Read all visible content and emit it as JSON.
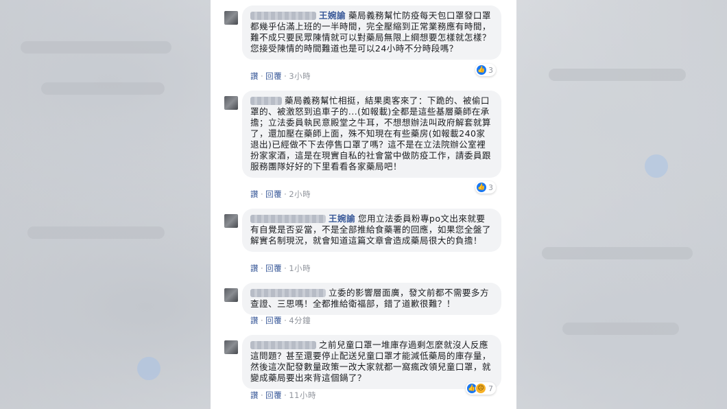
{
  "comments": [
    {
      "author": "王婉諭",
      "text": "藥局義務幫忙防疫每天包口罩發口罩都幾乎佔滿上班的一半時間，完全壓縮到正常業務應有時間，難不成只要民眾陳情就可以對藥局無限上綱想要怎樣就怎樣？您接受陳情的時間難道也是可以24小時不分時段嗎？",
      "reply_label": "讚",
      "reply_action": "回覆",
      "time": "3小時",
      "reaction_count": "3"
    },
    {
      "author": "",
      "text": "藥局義務幫忙相挺，結果奧客來了：下跪的、被偷口罩的、被激怒到追車子的...(如報載)全都是這些基層藥師在承擔；立法委員執民意殿堂之牛耳，不想想辦法叫政府解套就算了，還加壓在藥師上面，殊不知現在有些藥房(如報載240家退出)已經做不下去停售口罩了嗎？這不是在立法院辦公室裡扮家家酒，這是在現實自私的社會當中做防疫工作，請委員跟服務團隊好好的下里看看各家藥局吧！",
      "reply_label": "讚",
      "reply_action": "回覆",
      "time": "2小時",
      "reaction_count": "3"
    },
    {
      "author": "王婉諭",
      "text": "您用立法委員粉專po文出來就要有自覺是否妥當，不是全部推給食藥署的回應，如果您全盤了解實名制現況，就會知道這篇文章會造成藥局很大的負擔！",
      "reply_label": "讚",
      "reply_action": "回覆",
      "time": "1小時",
      "reaction_count": ""
    },
    {
      "author": "",
      "text": "立委的影響層面廣，發文前都不需要多方查證、三思嗎！全都推給衛福部，錯了道歉很難？！",
      "reply_label": "讚",
      "reply_action": "回覆",
      "time": "4分鐘",
      "reaction_count": ""
    },
    {
      "author": "",
      "text": "之前兒童口罩一堆庫存過剩怎麼就沒人反應這問題？甚至還要停止配送兒童口罩才能減低藥局的庫存量，然後這次配發數量政策一改大家就都一窩瘋改領兒童口罩，就變成藥局要出來背這個鍋了？",
      "reply_label": "讚",
      "reply_action": "回覆",
      "time": "11小時",
      "reaction_count": "7"
    }
  ],
  "icons": {
    "like": "like-icon",
    "sad": "sad-icon"
  },
  "colors": {
    "link": "#385898",
    "bubble": "#f2f3f5",
    "like": "#1877f2"
  }
}
